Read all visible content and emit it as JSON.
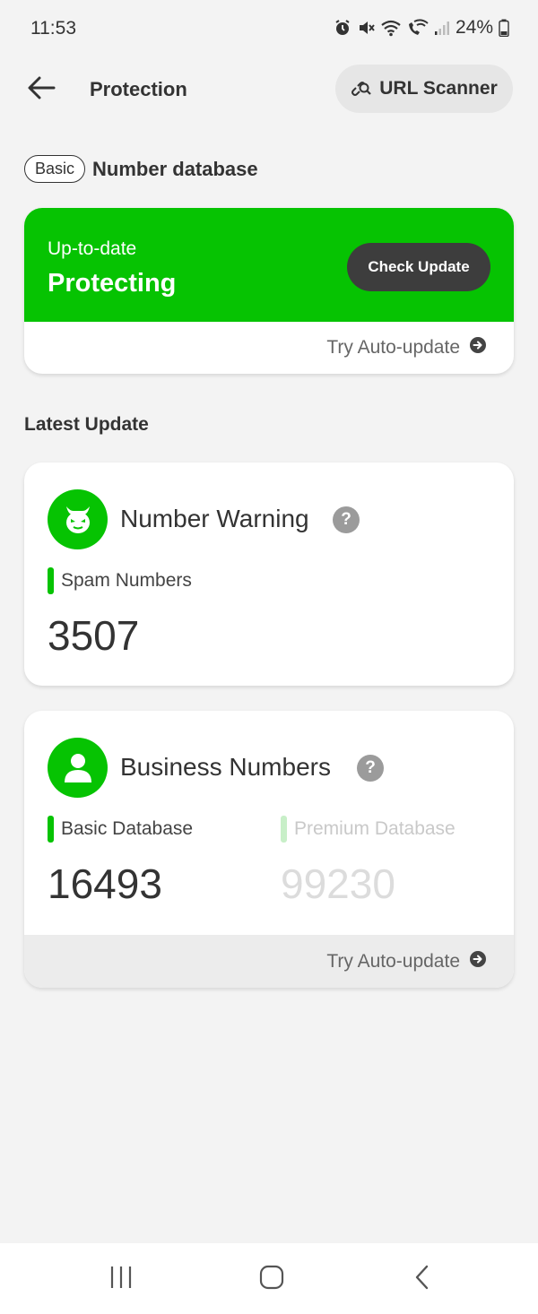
{
  "status_bar": {
    "time": "11:53",
    "battery": "24%",
    "icons": [
      "alarm-icon",
      "mute-icon",
      "wifi-icon",
      "wifi-calling-icon",
      "signal-icon",
      "battery-icon"
    ]
  },
  "header": {
    "title": "Protection",
    "url_scanner_label": "URL Scanner"
  },
  "database": {
    "tier_badge": "Basic",
    "title": "Number database"
  },
  "status_card": {
    "subtitle": "Up-to-date",
    "status": "Protecting",
    "check_button": "Check Update",
    "auto_update_link": "Try Auto-update",
    "accent_color": "#06c302"
  },
  "latest": {
    "title": "Latest Update"
  },
  "number_warning": {
    "title": "Number Warning",
    "help": "?",
    "stat_label": "Spam Numbers",
    "stat_value": "3507"
  },
  "business_numbers": {
    "title": "Business Numbers",
    "help": "?",
    "basic_label": "Basic Database",
    "basic_value": "16493",
    "premium_label": "Premium Database",
    "premium_value": "99230",
    "auto_update_link": "Try Auto-update"
  }
}
